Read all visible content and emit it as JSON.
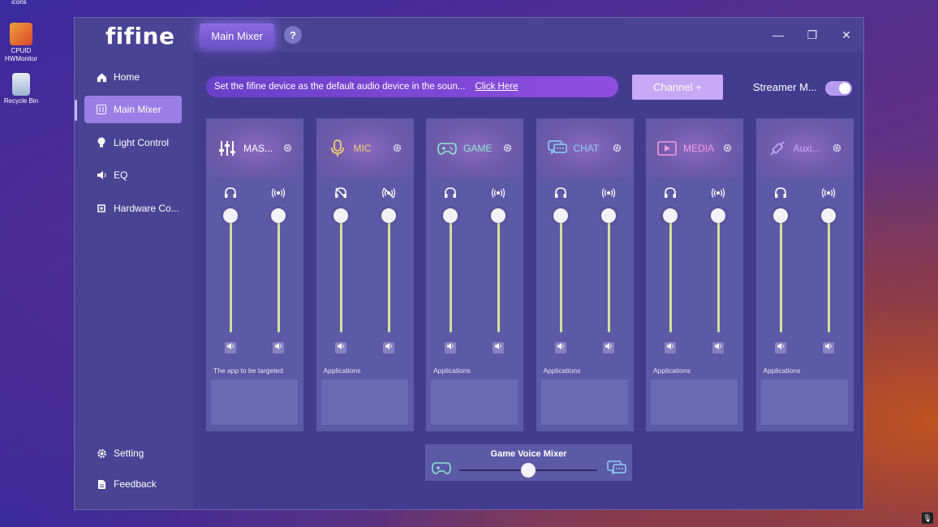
{
  "desktop": {
    "top_label": "icons",
    "icons": [
      {
        "label_line1": "CPUID",
        "label_line2": "HWMonitor"
      },
      {
        "label_line1": "Recycle Bin",
        "label_line2": ""
      }
    ]
  },
  "app": {
    "logo": "fifine",
    "nav": {
      "items": [
        "Home",
        "Main Mixer",
        "Light Control",
        "EQ",
        "Hardware Co..."
      ],
      "bottom": [
        "Setting",
        "Feedback"
      ],
      "active": "Main Mixer"
    },
    "tab_label": "Main Mixer",
    "help_label": "?",
    "window_controls": {
      "minimize": "—",
      "maximize": "❐",
      "close": "✕"
    },
    "banner": {
      "text": "Set the fifine device as the default audio device in the soun...",
      "link": "Click Here"
    },
    "channel_button": "Channel +",
    "streamer_mode": {
      "label": "Streamer M...",
      "enabled": true
    },
    "channels": [
      {
        "name": "MAS...",
        "icon": "sliders-icon",
        "color": "#ffffff",
        "apps_label": "The app to be targeted",
        "headphone_muted": false,
        "stream_muted": false
      },
      {
        "name": "MIC",
        "icon": "microphone-icon",
        "color": "#f2d26a",
        "apps_label": "Applications",
        "headphone_muted": true,
        "stream_muted": true
      },
      {
        "name": "GAME",
        "icon": "gamepad-icon",
        "color": "#8ee6d0",
        "apps_label": "Applications",
        "headphone_muted": false,
        "stream_muted": false
      },
      {
        "name": "CHAT",
        "icon": "chat-icon",
        "color": "#8fd0f5",
        "apps_label": "Applications",
        "headphone_muted": false,
        "stream_muted": false
      },
      {
        "name": "MEDIA",
        "icon": "play-icon",
        "color": "#f59adf",
        "apps_label": "Applications",
        "headphone_muted": false,
        "stream_muted": false
      },
      {
        "name": "Auxi...",
        "icon": "aux-cable-icon",
        "color": "#c7a8f5",
        "apps_label": "Applications",
        "headphone_muted": false,
        "stream_muted": false
      }
    ],
    "fader_level": 1.0,
    "game_voice_mixer": {
      "title": "Game Voice Mixer",
      "balance": 0.5
    }
  }
}
